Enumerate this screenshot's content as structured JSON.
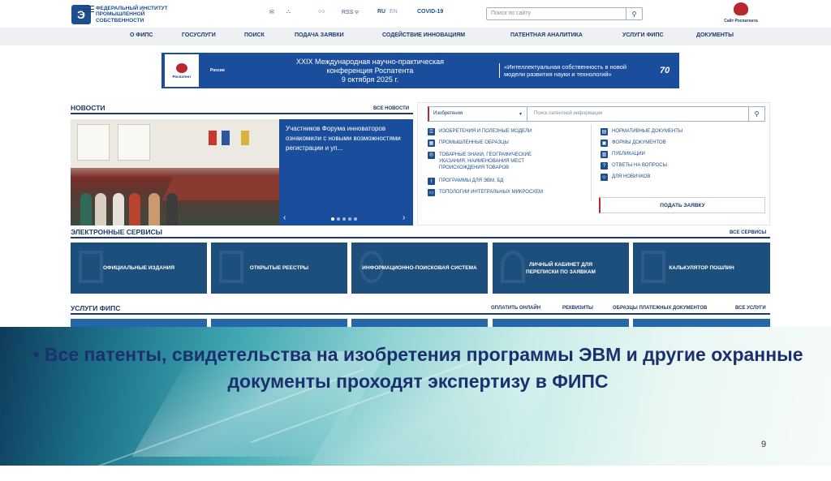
{
  "header": {
    "logo_text": "Федеральный институт промышленной собственности",
    "lang_ru": "RU",
    "lang_en": "EN",
    "rss": "RSS",
    "covid": "COVID-19",
    "search_placeholder": "Поиск по сайту",
    "rospatent_label": "Сайт Роспатента"
  },
  "nav": {
    "items": [
      "О ФИПС",
      "Госуслуги",
      "Поиск",
      "Подача заявки",
      "Содействие инновациям",
      "Патентная аналитика",
      "Услуги ФИПС",
      "Документы"
    ]
  },
  "banner": {
    "rospatent": "Роспатент",
    "russia": "Россия",
    "conference_line1": "XXIX Международная научно-практическая",
    "conference_line2": "конференция Роспатента",
    "conference_date": "9 октября 2025 г.",
    "quote": "«Интеллектуальная собственность в новой модели развития науки и технологий»",
    "anniversary": "70"
  },
  "news": {
    "title": "Новости",
    "all_link": "Все новости",
    "card_text": "Участников Форума инноваторов ознакомили с новыми возможностями регистрации и уп...",
    "prev": "‹",
    "next": "›"
  },
  "patent_search": {
    "category_selected": "Изобретения",
    "query_placeholder": "Поиск патентной информации",
    "left_links": [
      "Изобретения и полезные модели",
      "Промышленные образцы",
      "Товарные знаки, географические указания, наименования мест происхождения товаров",
      "Программы для ЭВМ, БД",
      "Топологии интегральных микросхем"
    ],
    "right_links": [
      "Нормативные документы",
      "Формы документов",
      "Публикации",
      "Ответы на вопросы",
      "Для новичков"
    ],
    "submit_label": "Подать заявку"
  },
  "eservices": {
    "title": "Электронные сервисы",
    "all_link": "Все сервисы",
    "tiles": [
      "Официальные издания",
      "Открытые реестры",
      "Информационно-поисковая система",
      "Личный кабинет для переписки по заявкам",
      "Калькулятор пошлин"
    ]
  },
  "fips_services": {
    "title": "Услуги ФИПС",
    "links": [
      "Оплатить онлайн",
      "Реквизиты",
      "Образцы платежных документов",
      "Все услуги"
    ]
  },
  "slide": {
    "bullet_text": "• Все патенты, свидетельства на изобретения программы ЭВМ и другие охранные документы проходят экспертизу в ФИПС",
    "page_number": "9"
  },
  "colors": {
    "brand_blue": "#1a4d9c",
    "tile_blue": "#1d4f7c",
    "accent_red": "#b7292f",
    "text_navy": "#1d3a6b"
  }
}
